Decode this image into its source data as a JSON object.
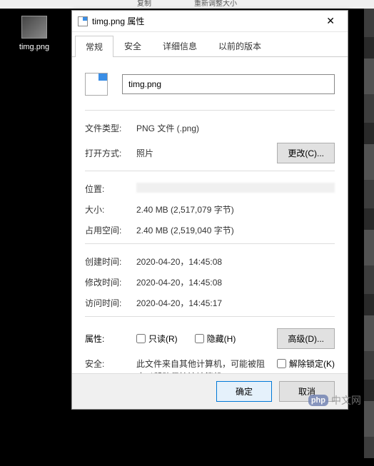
{
  "topbar": {
    "copy": "复制",
    "resize": "重新调整大小"
  },
  "desktop": {
    "icon_label": "timg.png"
  },
  "dialog": {
    "title": "timg.png 属性",
    "tabs": {
      "general": "常规",
      "security": "安全",
      "details": "详细信息",
      "previous": "以前的版本"
    },
    "filename_value": "timg.png",
    "labels": {
      "filetype": "文件类型:",
      "openwith": "打开方式:",
      "location": "位置:",
      "size": "大小:",
      "diskspace": "占用空间:",
      "created": "创建时间:",
      "modified": "修改时间:",
      "accessed": "访问时间:",
      "attributes": "属性:",
      "sec": "安全:"
    },
    "values": {
      "filetype": "PNG 文件 (.png)",
      "openwith": "照片",
      "location": "",
      "size": "2.40 MB (2,517,079 字节)",
      "diskspace": "2.40 MB (2,519,040 字节)",
      "created": "2020-04-20，14:45:08",
      "modified": "2020-04-20，14:45:08",
      "accessed": "2020-04-20，14:45:17",
      "sec_note": "此文件来自其他计算机，可能被阻止以帮助保护该计算机。"
    },
    "buttons": {
      "change": "更改(C)...",
      "advanced": "高级(D)...",
      "ok": "确定",
      "cancel": "取消"
    },
    "checkboxes": {
      "readonly": "只读(R)",
      "hidden": "隐藏(H)",
      "unblock": "解除锁定(K)"
    }
  },
  "watermark": {
    "php": "php",
    "text": "中文网"
  }
}
